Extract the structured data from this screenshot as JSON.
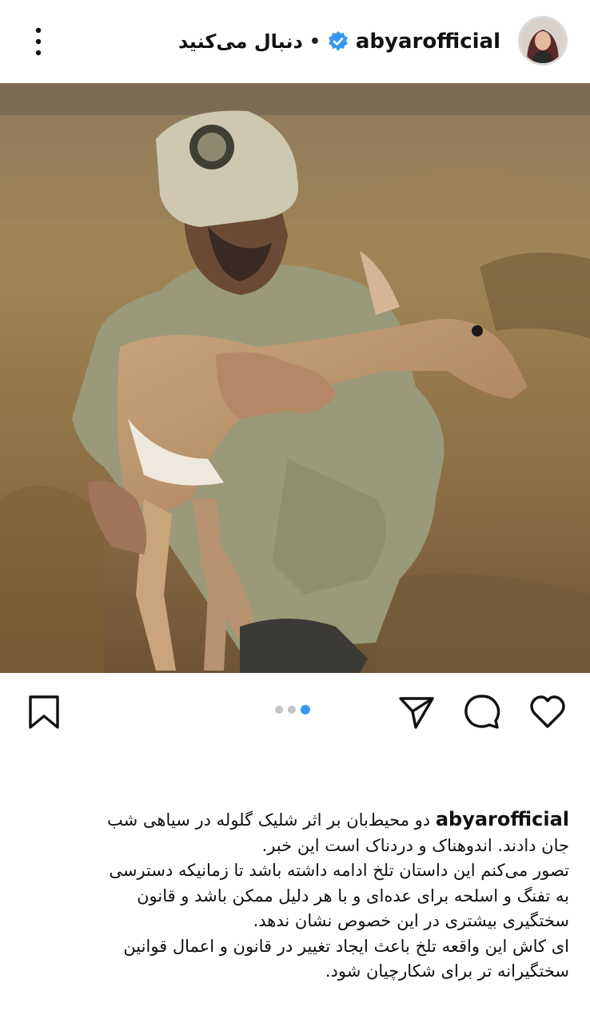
{
  "header": {
    "username": "abyarofficial",
    "separator": "•",
    "follow_label": "دنبال می‌کنید"
  },
  "icons": {
    "avatar": "profile-avatar",
    "verified": "verified-badge-icon",
    "more": "more-vertical-icon",
    "bookmark": "bookmark-icon",
    "share": "send-icon",
    "comment": "comment-icon",
    "like": "heart-icon"
  },
  "colors": {
    "verified": "#3897f0",
    "active_dot": "#3897f0",
    "inactive_dot": "#c4c4c4"
  },
  "carousel": {
    "count": 3,
    "active_index": 3
  },
  "caption": {
    "username": "abyarofficial",
    "lines": [
      "دو محیط‌بان بر اثر شلیک گلوله در سیاهی شب",
      "جان دادند. اندوهناک و دردناک است این خبر.",
      "تصور می‌کنم این داستان تلخ ادامه داشته باشد تا زمانیکه دسترسی",
      "به تفنگ و اسلحه برای عده‌ای و با هر دلیل ممکن باشد و قانون",
      "سختگیری بیشتری در این خصوص نشان ندهد.",
      "ای کاش این واقعه تلخ باعث ایجاد تغییر در قانون و اعمال قوانین",
      "سختگیرانه تر برای شکارچیان شود."
    ]
  }
}
